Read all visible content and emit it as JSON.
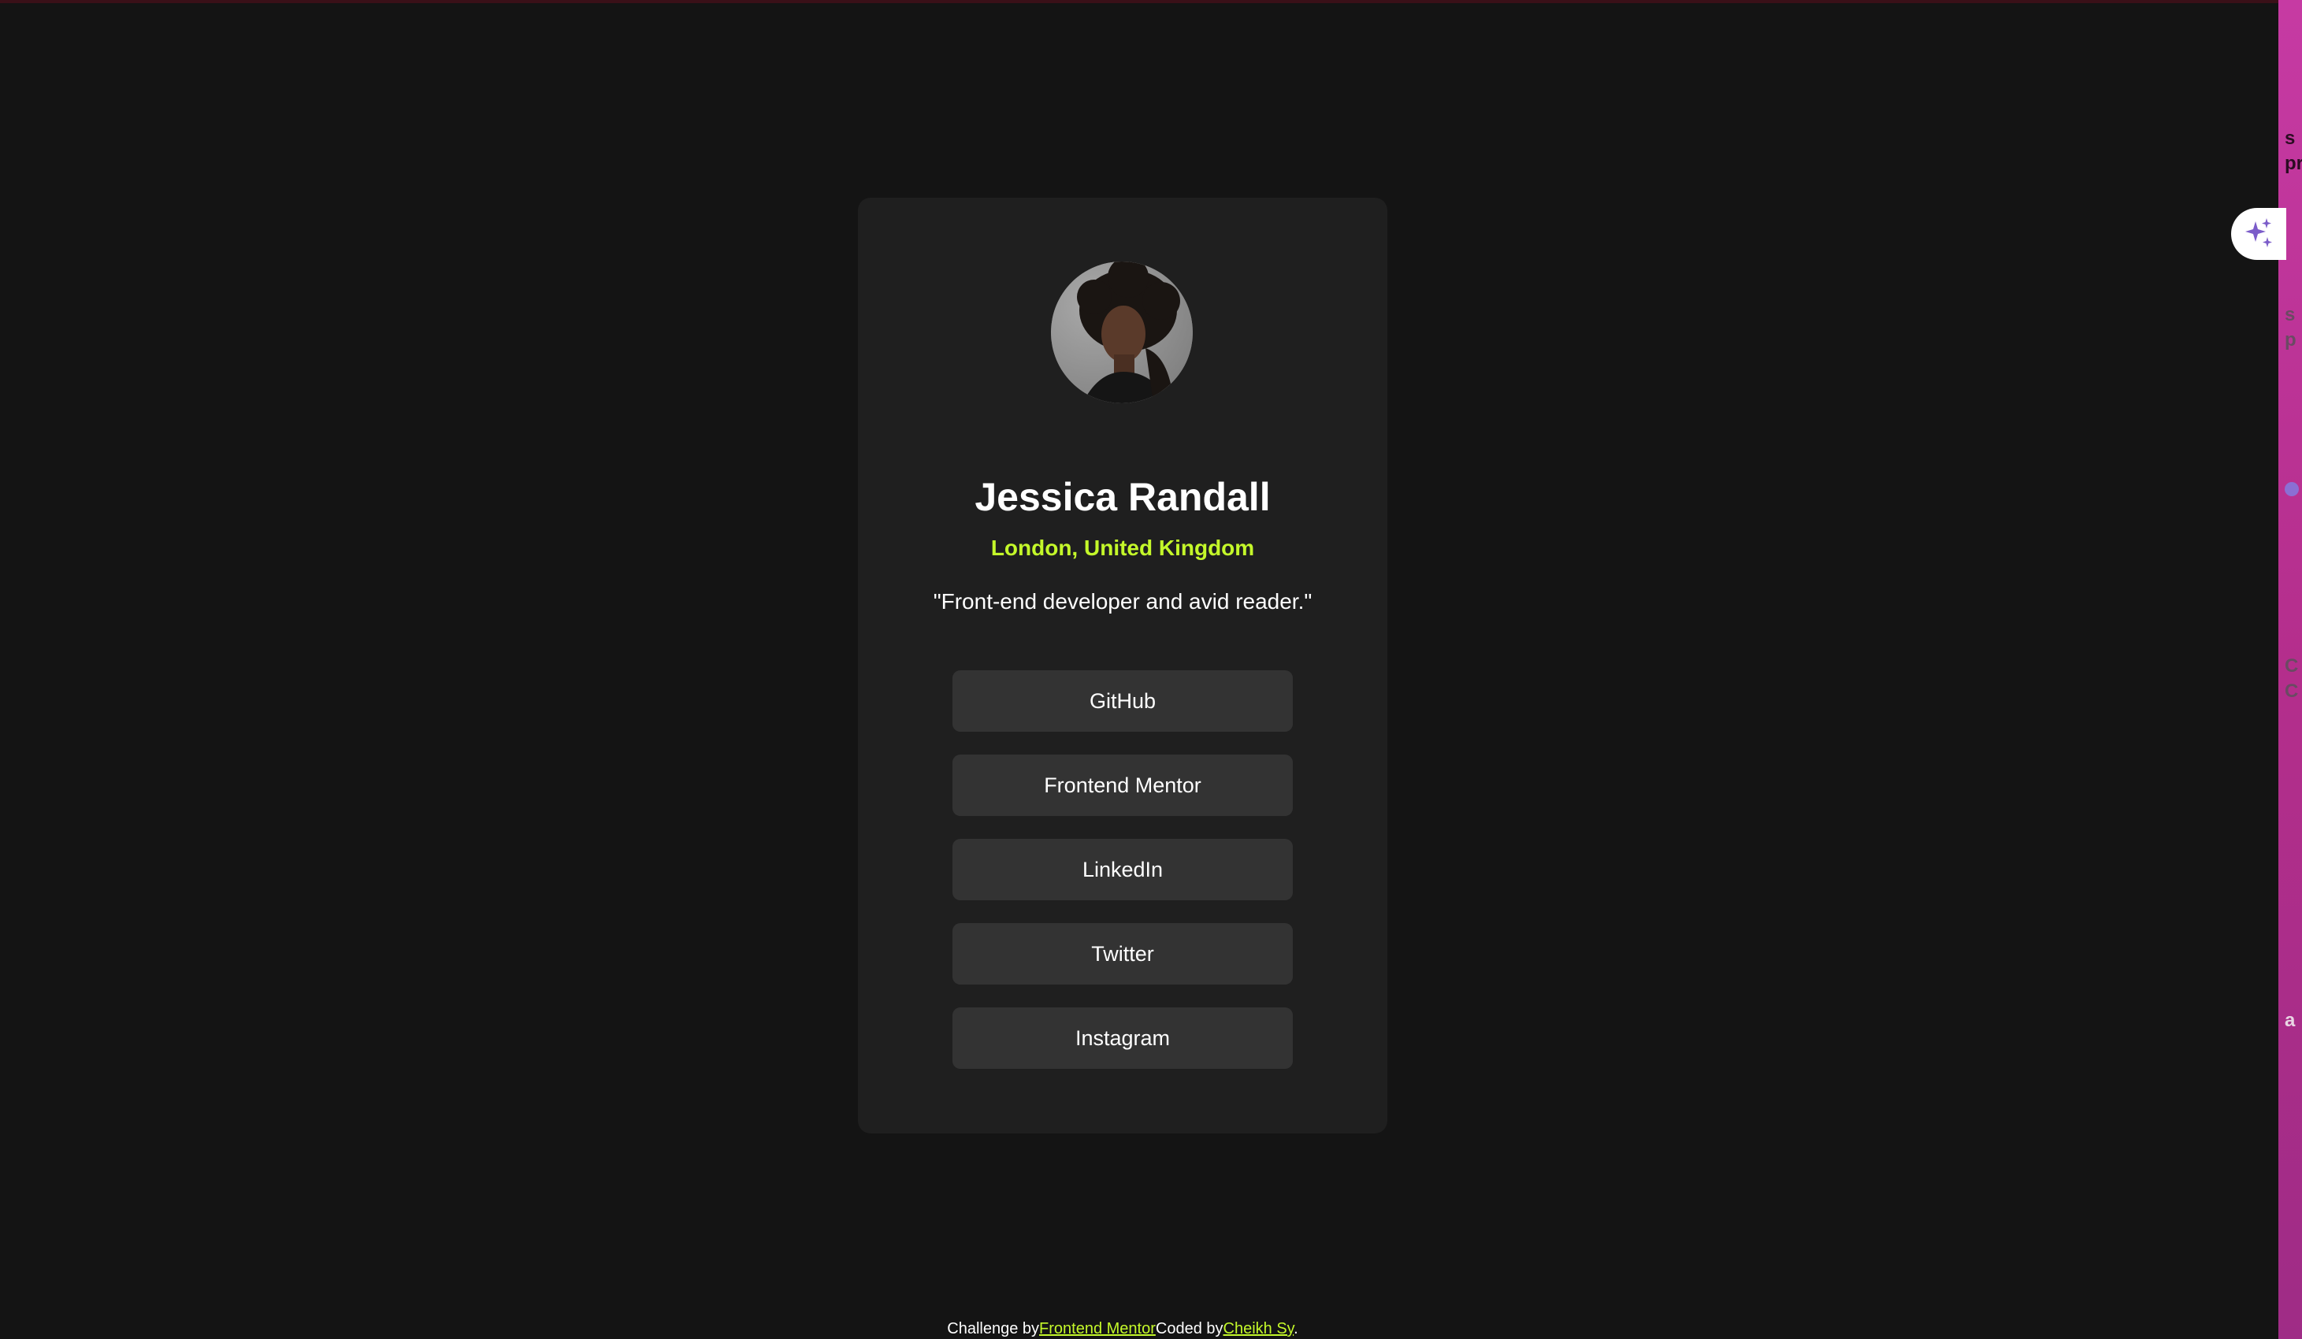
{
  "profile": {
    "name": "Jessica Randall",
    "location": "London, United Kingdom",
    "bio": "\"Front-end developer and avid reader.\""
  },
  "links": [
    {
      "label": "GitHub"
    },
    {
      "label": "Frontend Mentor"
    },
    {
      "label": "LinkedIn"
    },
    {
      "label": "Twitter"
    },
    {
      "label": "Instagram"
    }
  ],
  "footer": {
    "challenge_prefix": "Challenge by",
    "challenge_link": "Frontend Mentor",
    "coded_prefix": "Coded by",
    "coded_link": "Cheikh Sy",
    "suffix": "."
  },
  "side_panel": {
    "fragments": [
      "s",
      "pr",
      "s",
      "p",
      "C",
      "C",
      "a"
    ]
  },
  "icons": {
    "assistant": "sparkle-icon"
  },
  "colors": {
    "background": "#141414",
    "card": "#1f1f1f",
    "button": "#333333",
    "accent": "#c4f82a",
    "text": "#ffffff"
  }
}
